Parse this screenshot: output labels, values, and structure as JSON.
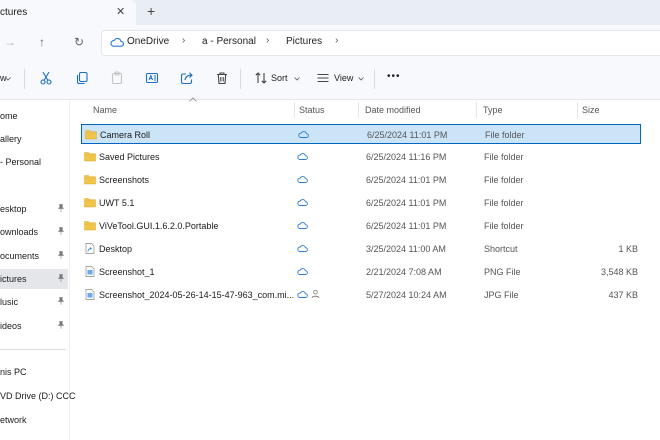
{
  "tab": {
    "title": "ctures",
    "close": "✕",
    "new_tab": "+"
  },
  "nav": {
    "forward": "→",
    "up": "↑",
    "refresh": "↻"
  },
  "breadcrumb": {
    "items": [
      "OneDrive",
      "a - Personal",
      "Pictures"
    ],
    "separator": "›"
  },
  "commands": {
    "new": "w",
    "sort": "Sort",
    "view": "View",
    "more": "•••"
  },
  "sidebar": {
    "items": [
      {
        "label": "ome",
        "pinned": false,
        "selected": false
      },
      {
        "label": "allery",
        "pinned": false,
        "selected": false
      },
      {
        "label": "- Personal",
        "pinned": false,
        "selected": false
      },
      {
        "label": "esktop",
        "pinned": true,
        "selected": false
      },
      {
        "label": "ownloads",
        "pinned": true,
        "selected": false
      },
      {
        "label": "ocuments",
        "pinned": true,
        "selected": false
      },
      {
        "label": "ictures",
        "pinned": true,
        "selected": true
      },
      {
        "label": "lusic",
        "pinned": true,
        "selected": false
      },
      {
        "label": "ideos",
        "pinned": true,
        "selected": false
      },
      {
        "label": "nis PC",
        "pinned": false,
        "selected": false
      },
      {
        "label": "VD Drive (D:) CCC",
        "pinned": false,
        "selected": false
      },
      {
        "label": "etwork",
        "pinned": false,
        "selected": false
      }
    ]
  },
  "columns": {
    "name": "Name",
    "status": "Status",
    "date": "Date modified",
    "type": "Type",
    "size": "Size"
  },
  "files": [
    {
      "name": "Camera Roll",
      "icon": "folder-icon",
      "date": "6/25/2024 11:01 PM",
      "type": "File folder",
      "size": "",
      "selected": true
    },
    {
      "name": "Saved Pictures",
      "icon": "folder-icon",
      "date": "6/25/2024 11:16 PM",
      "type": "File folder",
      "size": "",
      "selected": false
    },
    {
      "name": "Screenshots",
      "icon": "folder-icon",
      "date": "6/25/2024 11:01 PM",
      "type": "File folder",
      "size": "",
      "selected": false
    },
    {
      "name": "UWT 5.1",
      "icon": "folder-icon",
      "date": "6/25/2024 11:01 PM",
      "type": "File folder",
      "size": "",
      "selected": false
    },
    {
      "name": "ViVeTool.GUI.1.6.2.0.Portable",
      "icon": "folder-icon",
      "date": "6/25/2024 11:01 PM",
      "type": "File folder",
      "size": "",
      "selected": false
    },
    {
      "name": "Desktop",
      "icon": "shortcut-icon",
      "date": "3/25/2024 11:00 AM",
      "type": "Shortcut",
      "size": "1 KB",
      "selected": false
    },
    {
      "name": "Screenshot_1",
      "icon": "image-file-icon",
      "date": "2/21/2024 7:08 AM",
      "type": "PNG File",
      "size": "3,548 KB",
      "selected": false
    },
    {
      "name": "Screenshot_2024-05-26-14-15-47-963_com.mi...",
      "icon": "image-file-icon",
      "date": "5/27/2024 10:24 AM",
      "type": "JPG File",
      "size": "437 KB",
      "selected": false,
      "shared": true
    }
  ],
  "colors": {
    "accent": "#0067c0",
    "selection": "#cce4f7",
    "folder": "#f0c54a",
    "cloud": "#2b7bd4"
  }
}
